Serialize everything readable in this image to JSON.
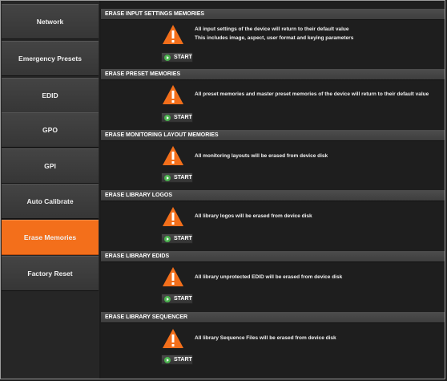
{
  "sidebar": {
    "items": [
      {
        "label": "Network"
      },
      {
        "label": "Emergency Presets"
      },
      {
        "label": "EDID"
      },
      {
        "label": "GPO"
      },
      {
        "label": "GPI"
      },
      {
        "label": "Auto Calibrate"
      },
      {
        "label": "Erase Memories",
        "active": true
      },
      {
        "label": "Factory Reset"
      }
    ],
    "accent_color": "#f36f1b"
  },
  "sections": [
    {
      "title": "ERASE INPUT SETTINGS MEMORIES",
      "lines": [
        "All input settings of the device will return to their default value",
        "This includes image, aspect, user format and keying parameters"
      ],
      "button": "START",
      "icon": "warning-icon"
    },
    {
      "title": "ERASE PRESET MEMORIES",
      "lines": [
        "All preset memories and master preset memories of the device will return to their default value"
      ],
      "button": "START",
      "icon": "warning-icon"
    },
    {
      "title": "ERASE MONITORING LAYOUT MEMORIES",
      "lines": [
        "All monitoring layouts will be erased from device disk"
      ],
      "button": "START",
      "icon": "warning-icon"
    },
    {
      "title": "ERASE LIBRARY LOGOS",
      "lines": [
        "All library logos will be erased from device disk"
      ],
      "button": "START",
      "icon": "warning-icon"
    },
    {
      "title": "ERASE LIBRARY EDIDS",
      "lines": [
        "All library unprotected EDID will be erased from device disk"
      ],
      "button": "START",
      "icon": "warning-icon"
    },
    {
      "title": "ERASE LIBRARY SEQUENCER",
      "lines": [
        "All library Sequence Files will be erased from device disk"
      ],
      "button": "START",
      "icon": "warning-icon"
    }
  ]
}
